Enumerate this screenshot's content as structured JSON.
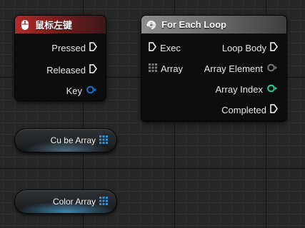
{
  "mouse_node": {
    "title": "鼠标左键",
    "icon": "mouse-icon",
    "accent": "#b42a2a",
    "pins": {
      "pressed": "Pressed",
      "released": "Released",
      "key": "Key"
    }
  },
  "loop_node": {
    "title": "For Each Loop",
    "icon": "loop-icon",
    "accent": "#8d8d8d",
    "inputs": {
      "exec": "Exec",
      "array": "Array"
    },
    "outputs": {
      "loop_body": "Loop Body",
      "array_element": "Array Element",
      "array_index": "Array Index",
      "completed": "Completed"
    }
  },
  "variables": {
    "cube_array": "Cu be Array",
    "color_array": "Color Array",
    "array_pin_color": "#2f8fd8"
  },
  "pin_colors": {
    "exec": "#ffffff",
    "key": "#1a73d9",
    "wildcard": "#777777",
    "integer": "#24d1a0"
  }
}
